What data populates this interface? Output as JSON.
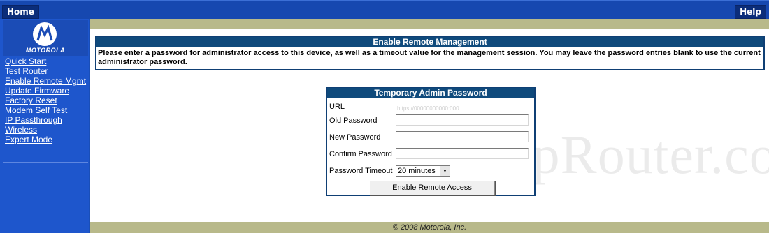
{
  "header": {
    "home_label": "Home",
    "help_label": "Help"
  },
  "brand": {
    "logo_text": "MOTOROLA"
  },
  "sidebar": {
    "items": [
      {
        "label": "Quick Start"
      },
      {
        "label": "Test Router"
      },
      {
        "label": "Enable Remote Mgmt"
      },
      {
        "label": "Update Firmware"
      },
      {
        "label": "Factory Reset"
      },
      {
        "label": "Modem Self Test"
      },
      {
        "label": "IP Passthrough"
      },
      {
        "label": "Wireless"
      },
      {
        "label": "Expert Mode"
      }
    ]
  },
  "info": {
    "title": "Enable Remote Management",
    "text": "Please enter a password for administrator access to this device, as well as a timeout value for the management session. You may leave the password entries blank to use the current administrator password."
  },
  "form": {
    "title": "Temporary Admin Password",
    "url_label": "URL",
    "url_value": "https://00000000000:000",
    "old_password_label": "Old Password",
    "new_password_label": "New Password",
    "confirm_password_label": "Confirm Password",
    "timeout_label": "Password Timeout",
    "timeout_value": "20 minutes",
    "submit_label": "Enable Remote Access"
  },
  "footer": {
    "copyright": "© 2008 Motorola, Inc."
  },
  "watermark": "SetupRouter.co",
  "colors": {
    "sidebar_blue": "#1e56cc",
    "header_navy": "#0f4a7c",
    "olive": "#b8b98a"
  }
}
